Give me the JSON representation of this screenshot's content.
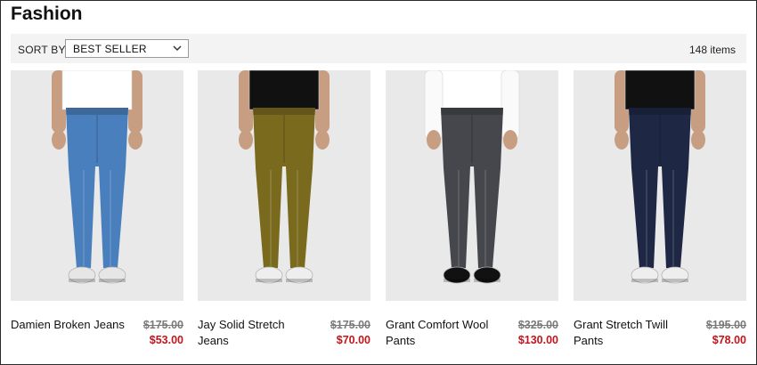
{
  "page": {
    "title": "Fashion"
  },
  "toolbar": {
    "sort_label": "SORT BY:",
    "sort_value": "BEST SELLER",
    "item_count": "148 items"
  },
  "products": [
    {
      "name": "Damien Broken Jeans",
      "old_price": "$175.00",
      "price": "$53.00",
      "pant_color": "#4a7fbd",
      "shirt_color": "#ffffff",
      "shoe_color": "#e6e6e6"
    },
    {
      "name": "Jay Solid Stretch Jeans",
      "old_price": "$175.00",
      "price": "$70.00",
      "pant_color": "#7a6a1e",
      "shirt_color": "#111111",
      "shoe_color": "#eeeeee"
    },
    {
      "name": "Grant Comfort Wool Pants",
      "old_price": "$325.00",
      "price": "$130.00",
      "pant_color": "#45474c",
      "shirt_color": "#ffffff",
      "shoe_color": "#111111"
    },
    {
      "name": "Grant Stretch Twill Pants",
      "old_price": "$195.00",
      "price": "$78.00",
      "pant_color": "#1e2845",
      "shirt_color": "#111111",
      "shoe_color": "#eeeeee"
    }
  ],
  "colors": {
    "sale_red": "#c0161c",
    "strike_gray": "#7a7a7a",
    "toolbar_bg": "#f3f3f3"
  }
}
